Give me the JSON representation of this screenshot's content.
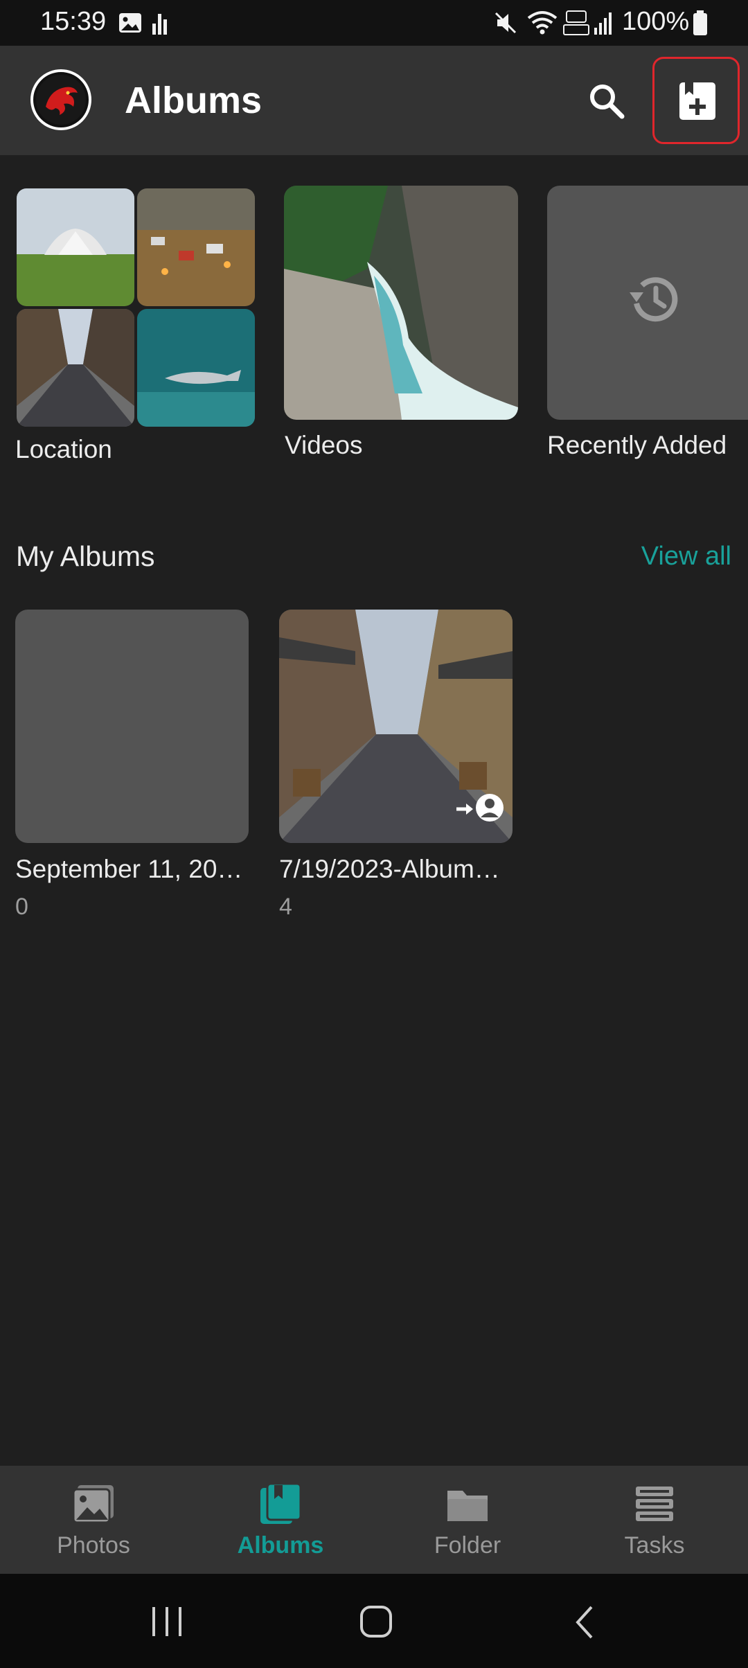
{
  "status_bar": {
    "time": "15:39",
    "battery": "100%"
  },
  "app_bar": {
    "title": "Albums"
  },
  "categories": [
    {
      "label": "Location"
    },
    {
      "label": "Videos"
    },
    {
      "label": "Recently Added"
    }
  ],
  "my_albums": {
    "title": "My Albums",
    "view_all": "View all",
    "albums": [
      {
        "name": "September 11, 20…",
        "count": "0"
      },
      {
        "name": "7/19/2023-Album…",
        "count": "4"
      }
    ]
  },
  "bottom_nav": {
    "items": [
      {
        "label": "Photos",
        "icon": "photos-icon",
        "active": false
      },
      {
        "label": "Albums",
        "icon": "albums-icon",
        "active": true
      },
      {
        "label": "Folder",
        "icon": "folder-icon",
        "active": false
      },
      {
        "label": "Tasks",
        "icon": "tasks-icon",
        "active": false
      }
    ]
  },
  "colors": {
    "accent": "#139c96",
    "highlight": "#e0262c",
    "appbar": "#333333",
    "background": "#1f1f1f"
  }
}
